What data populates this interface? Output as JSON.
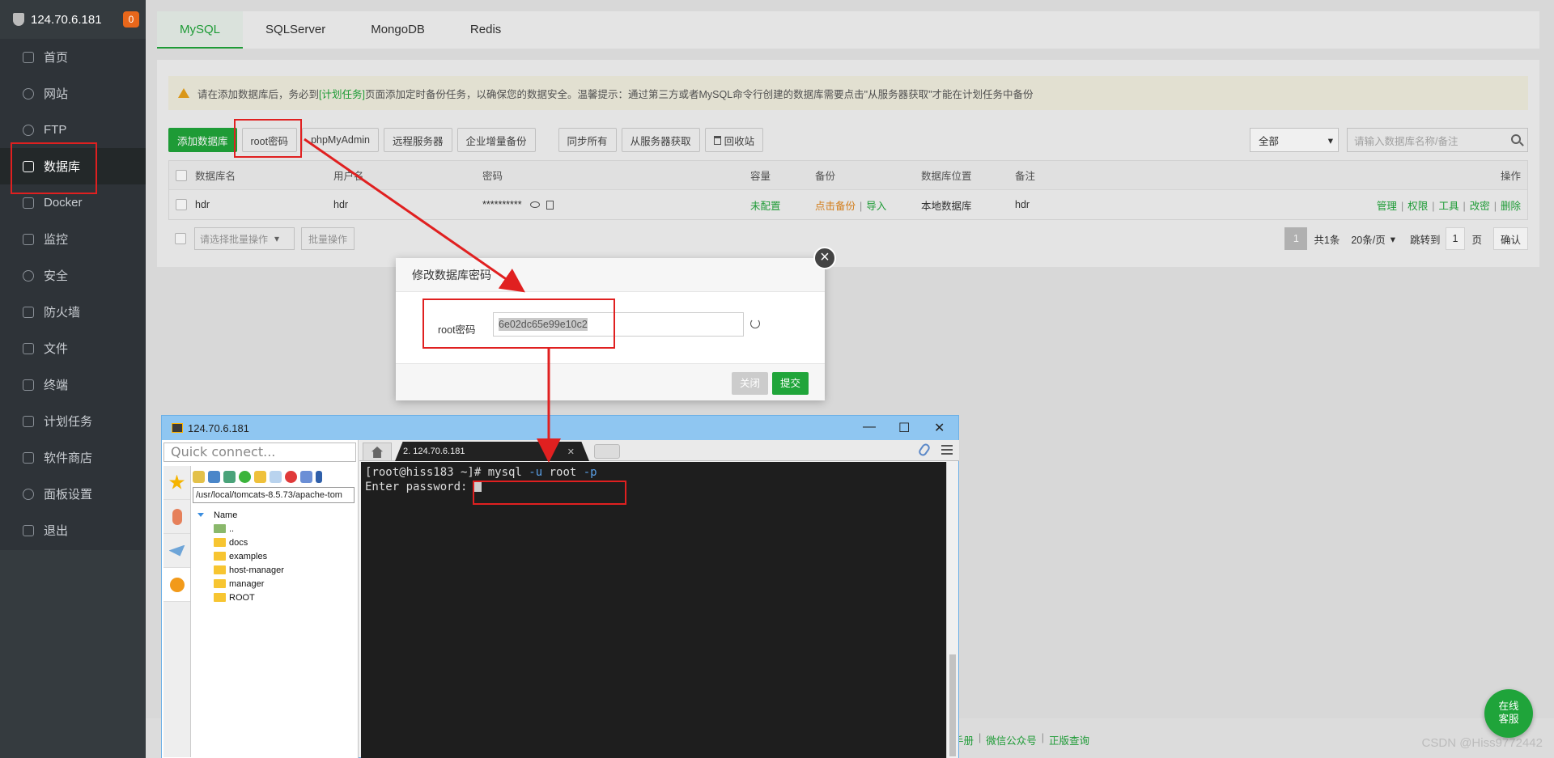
{
  "sidebar": {
    "server_ip": "124.70.6.181",
    "badge": "0",
    "items": [
      {
        "label": "首页",
        "icon": "home-icon"
      },
      {
        "label": "网站",
        "icon": "globe-icon"
      },
      {
        "label": "FTP",
        "icon": "ftp-icon"
      },
      {
        "label": "数据库",
        "icon": "database-icon",
        "active": true
      },
      {
        "label": "Docker",
        "icon": "docker-icon"
      },
      {
        "label": "监控",
        "icon": "monitor-icon"
      },
      {
        "label": "安全",
        "icon": "shield-icon"
      },
      {
        "label": "防火墙",
        "icon": "firewall-icon"
      },
      {
        "label": "文件",
        "icon": "folder-icon"
      },
      {
        "label": "终端",
        "icon": "terminal-icon"
      },
      {
        "label": "计划任务",
        "icon": "calendar-icon"
      },
      {
        "label": "软件商店",
        "icon": "apps-icon"
      },
      {
        "label": "面板设置",
        "icon": "settings-icon"
      },
      {
        "label": "退出",
        "icon": "logout-icon"
      }
    ]
  },
  "db_tabs": [
    "MySQL",
    "SQLServer",
    "MongoDB",
    "Redis"
  ],
  "notice": {
    "before": "请在添加数据库后，务必到",
    "link": "[计划任务]",
    "after": "页面添加定时备份任务，以确保您的数据安全。温馨提示：通过第三方或者MySQL命令行创建的数据库需要点击\"从服务器获取\"才能在计划任务中备份"
  },
  "toolbar": {
    "add_db": "添加数据库",
    "root_password": "root密码",
    "phpmyadmin": "phpMyAdmin",
    "remote_server": "远程服务器",
    "enterprise_backup": "企业增量备份",
    "sync_all": "同步所有",
    "fetch_from_server": "从服务器获取",
    "recycle_bin": "回收站",
    "filter_value": "全部",
    "search_placeholder": "请输入数据库名称/备注"
  },
  "table": {
    "headers": {
      "name": "数据库名",
      "user": "用户名",
      "password": "密码",
      "capacity": "容量",
      "backup": "备份",
      "location": "数据库位置",
      "note": "备注",
      "ops": "操作"
    },
    "row": {
      "name": "hdr",
      "user": "hdr",
      "password": "**********",
      "capacity": "未配置",
      "backup_click": "点击备份",
      "backup_import": "导入",
      "location": "本地数据库",
      "note": "hdr",
      "op_manage": "管理",
      "op_perm": "权限",
      "op_tools": "工具",
      "op_change_pwd": "改密",
      "op_delete": "删除"
    }
  },
  "batch": {
    "select_placeholder": "请选择批量操作",
    "batch_btn": "批量操作"
  },
  "pager": {
    "current": "1",
    "total": "共1条",
    "per_page": "20条/页",
    "goto_label": "跳转到",
    "goto_value": "1",
    "page_unit": "页",
    "confirm": "确认"
  },
  "modal": {
    "title": "修改数据库密码",
    "label": "root密码",
    "value": "6e02dc65e99e10c2",
    "close": "关闭",
    "submit": "提交"
  },
  "footer": {
    "links": [
      "手册",
      "微信公众号",
      "正版查询"
    ],
    "chat_line1": "在线",
    "chat_line2": "客服",
    "watermark": "CSDN @Hiss9772442"
  },
  "xshell": {
    "title": "124.70.6.181",
    "quick_connect": "Quick connect...",
    "path": "/usr/local/tomcats-8.5.73/apache-tom",
    "tree_header": "Name",
    "tree_items": [
      "..",
      "docs",
      "examples",
      "host-manager",
      "manager",
      "ROOT"
    ],
    "session_tab": "2. 124.70.6.181",
    "terminal": {
      "prompt": "[root@hiss183 ~]# ",
      "cmd_mysql": "mysql ",
      "flag_u": "-u",
      "cmd_root": " root ",
      "flag_p": "-p",
      "line2": "Enter password: "
    }
  },
  "colors": {
    "accent": "#20a53a",
    "sidebar": "#353b3f",
    "annotation_red": "#e02020"
  }
}
